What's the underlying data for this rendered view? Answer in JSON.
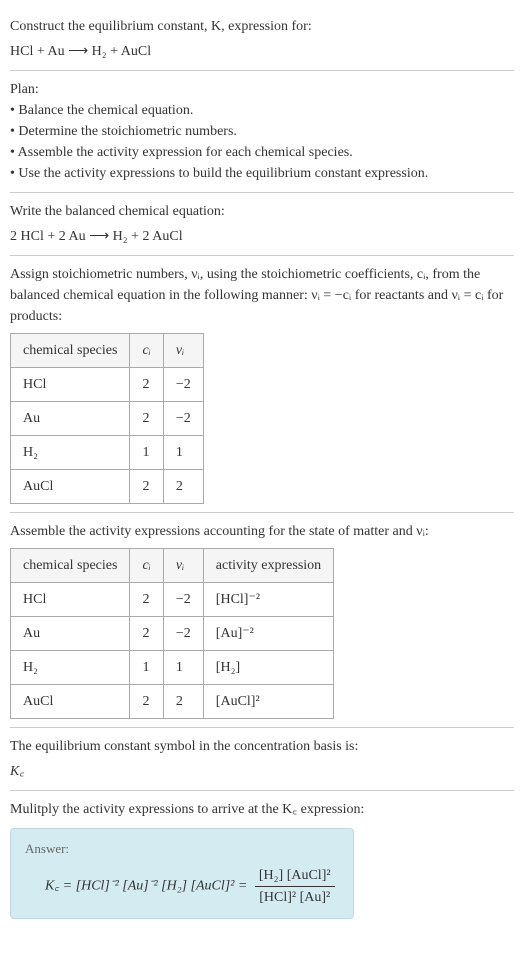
{
  "intro_line1": "Construct the equilibrium constant, K, expression for:",
  "intro_reaction": "HCl + Au ⟶ H₂ + AuCl",
  "plan_heading": "Plan:",
  "plan_items": [
    "• Balance the chemical equation.",
    "• Determine the stoichiometric numbers.",
    "• Assemble the activity expression for each chemical species.",
    "• Use the activity expressions to build the equilibrium constant expression."
  ],
  "balanced_heading": "Write the balanced chemical equation:",
  "balanced_reaction": "2 HCl + 2 Au ⟶ H₂ + 2 AuCl",
  "stoich_text_a": "Assign stoichiometric numbers, νᵢ, using the stoichiometric coefficients, cᵢ, from the balanced chemical equation in the following manner: νᵢ = −cᵢ for reactants and νᵢ = cᵢ for products:",
  "table1": {
    "headers": [
      "chemical species",
      "cᵢ",
      "νᵢ"
    ],
    "rows": [
      [
        "HCl",
        "2",
        "−2"
      ],
      [
        "Au",
        "2",
        "−2"
      ],
      [
        "H₂",
        "1",
        "1"
      ],
      [
        "AuCl",
        "2",
        "2"
      ]
    ]
  },
  "activity_heading": "Assemble the activity expressions accounting for the state of matter and νᵢ:",
  "table2": {
    "headers": [
      "chemical species",
      "cᵢ",
      "νᵢ",
      "activity expression"
    ],
    "rows": [
      {
        "species": "HCl",
        "c": "2",
        "v": "−2",
        "expr": "[HCl]⁻²"
      },
      {
        "species": "Au",
        "c": "2",
        "v": "−2",
        "expr": "[Au]⁻²"
      },
      {
        "species": "H₂",
        "c": "1",
        "v": "1",
        "expr": "[H₂]"
      },
      {
        "species": "AuCl",
        "c": "2",
        "v": "2",
        "expr": "[AuCl]²"
      }
    ]
  },
  "kc_symbol_text": "The equilibrium constant symbol in the concentration basis is:",
  "kc_symbol": "K꜀",
  "multiply_text": "Mulitply the activity expressions to arrive at the K꜀ expression:",
  "answer_label": "Answer:",
  "answer_lhs": "K꜀ = [HCl]⁻² [Au]⁻² [H₂] [AuCl]² =",
  "answer_frac_num": "[H₂] [AuCl]²",
  "answer_frac_den": "[HCl]² [Au]²",
  "chart_data": {
    "type": "table",
    "title": "Stoichiometric numbers and activity expressions",
    "tables": [
      {
        "columns": [
          "chemical species",
          "c_i",
          "nu_i"
        ],
        "rows": [
          [
            "HCl",
            2,
            -2
          ],
          [
            "Au",
            2,
            -2
          ],
          [
            "H2",
            1,
            1
          ],
          [
            "AuCl",
            2,
            2
          ]
        ]
      },
      {
        "columns": [
          "chemical species",
          "c_i",
          "nu_i",
          "activity expression"
        ],
        "rows": [
          [
            "HCl",
            2,
            -2,
            "[HCl]^-2"
          ],
          [
            "Au",
            2,
            -2,
            "[Au]^-2"
          ],
          [
            "H2",
            1,
            1,
            "[H2]"
          ],
          [
            "AuCl",
            2,
            2,
            "[AuCl]^2"
          ]
        ]
      }
    ]
  }
}
